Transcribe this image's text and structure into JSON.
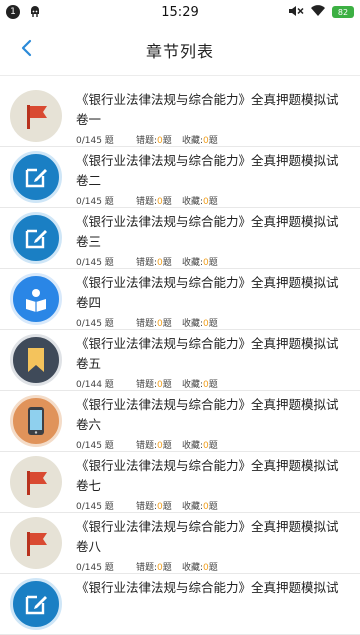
{
  "status_bar": {
    "notification_count": "1",
    "time": "15:29",
    "battery": "82"
  },
  "header": {
    "title": "章节列表"
  },
  "labels": {
    "wrong": "错题:",
    "favorite": "收藏:",
    "unit": "题"
  },
  "chapters": [
    {
      "title": "《银行业法律法规与综合能力》全真押题模拟试卷一",
      "progress": "0/145 题",
      "wrong": "0",
      "favorite": "0",
      "icon": "flag"
    },
    {
      "title": "《银行业法律法规与综合能力》全真押题模拟试卷二",
      "progress": "0/145 题",
      "wrong": "0",
      "favorite": "0",
      "icon": "edit"
    },
    {
      "title": "《银行业法律法规与综合能力》全真押题模拟试卷三",
      "progress": "0/145 题",
      "wrong": "0",
      "favorite": "0",
      "icon": "edit"
    },
    {
      "title": "《银行业法律法规与综合能力》全真押题模拟试卷四",
      "progress": "0/145 题",
      "wrong": "0",
      "favorite": "0",
      "icon": "reader"
    },
    {
      "title": "《银行业法律法规与综合能力》全真押题模拟试卷五",
      "progress": "0/144 题",
      "wrong": "0",
      "favorite": "0",
      "icon": "bookmark"
    },
    {
      "title": "《银行业法律法规与综合能力》全真押题模拟试卷六",
      "progress": "0/145 题",
      "wrong": "0",
      "favorite": "0",
      "icon": "phone"
    },
    {
      "title": "《银行业法律法规与综合能力》全真押题模拟试卷七",
      "progress": "0/145 题",
      "wrong": "0",
      "favorite": "0",
      "icon": "flag"
    },
    {
      "title": "《银行业法律法规与综合能力》全真押题模拟试卷八",
      "progress": "0/145 题",
      "wrong": "0",
      "favorite": "0",
      "icon": "flag"
    },
    {
      "title": "《银行业法律法规与综合能力》全真押题模拟试",
      "progress": "",
      "wrong": "",
      "favorite": "",
      "icon": "edit"
    }
  ],
  "colors": {
    "accent": "#2b8ad8",
    "count_highlight": "#f0a020"
  }
}
